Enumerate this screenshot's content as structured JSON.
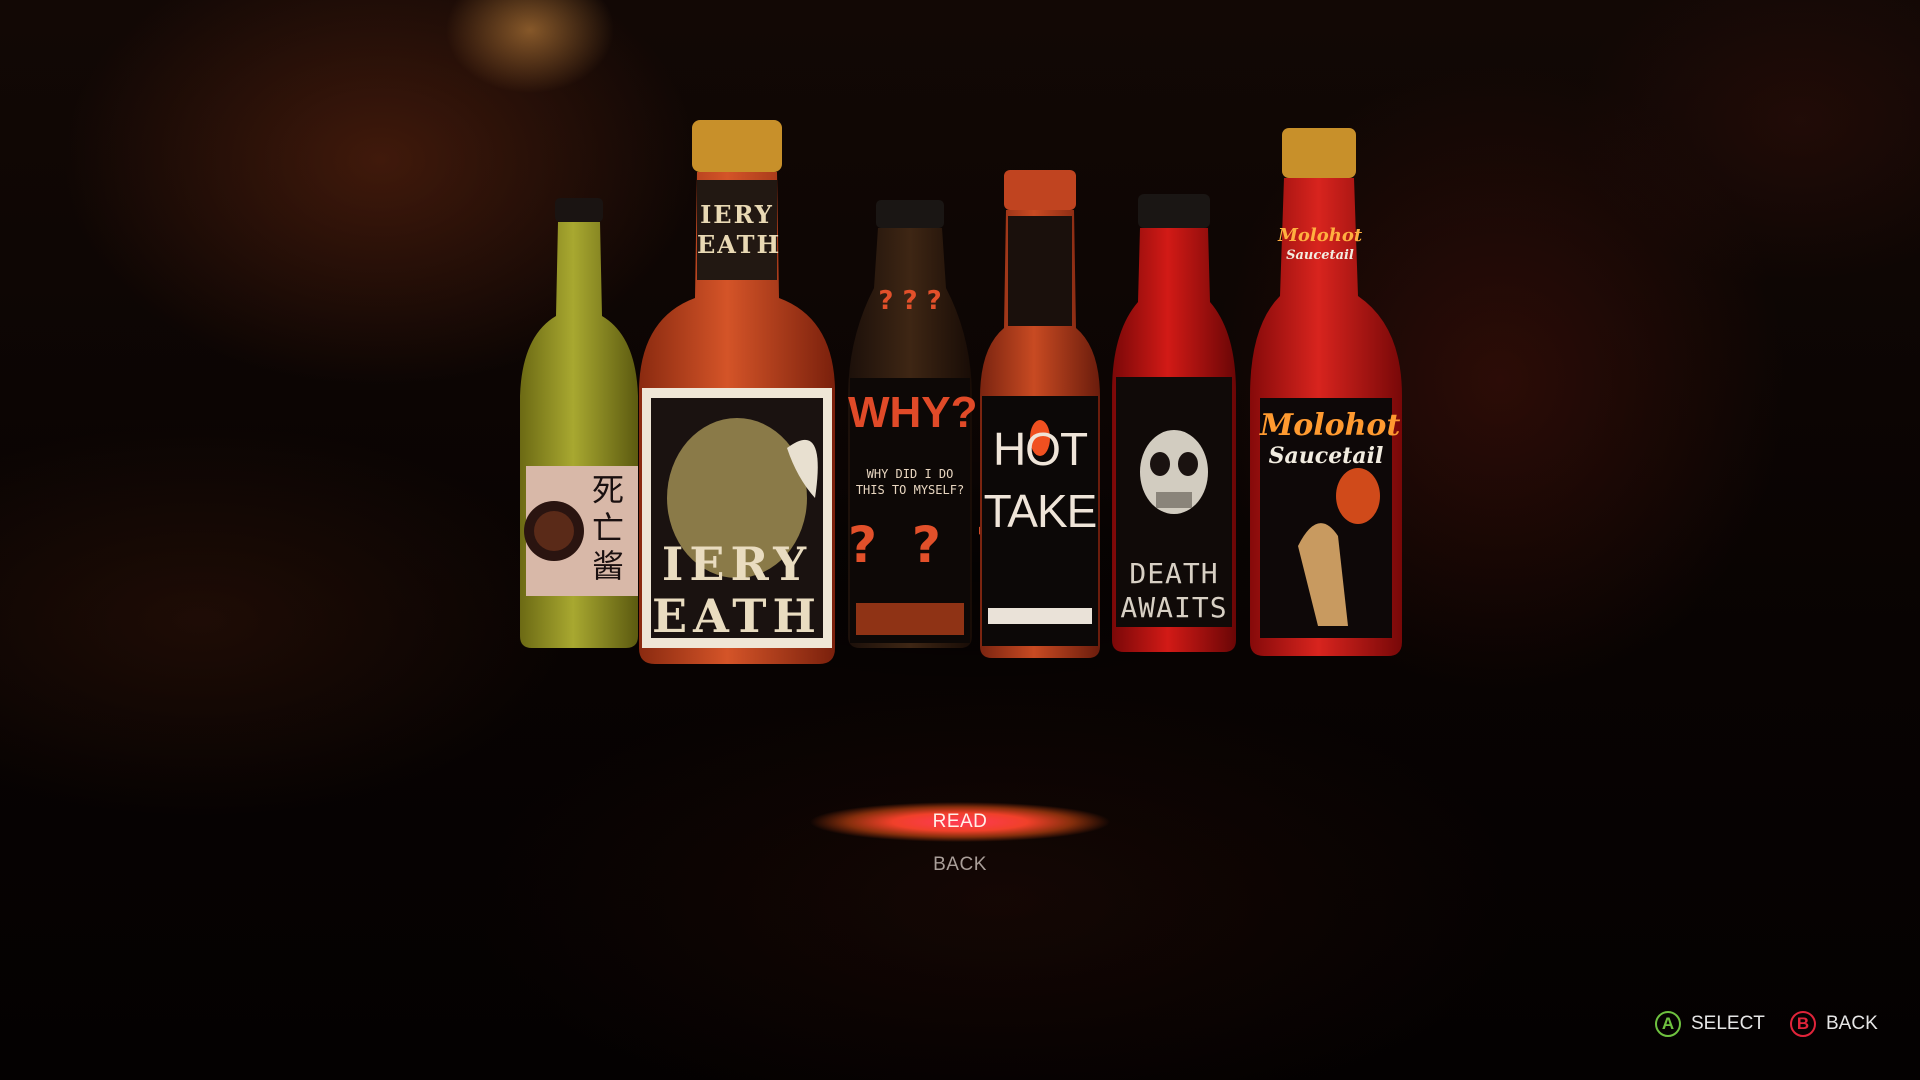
{
  "bottles": [
    {
      "name": "yellow-sauce",
      "label_lines": [
        "死",
        "亡",
        "酱"
      ]
    },
    {
      "name": "fiery-death",
      "neck_label": [
        "IERY",
        "EATH"
      ],
      "label_lines": [
        "IERY",
        "EATH"
      ]
    },
    {
      "name": "why",
      "label_title": "WHY?",
      "label_sub": [
        "WHY DID I DO",
        "THIS TO MYSELF?"
      ],
      "marks": "?  ?  ?",
      "neck_marks": "? ? ?"
    },
    {
      "name": "hot-take",
      "label_lines": [
        "HOT",
        "TAKE"
      ]
    },
    {
      "name": "death-awaits",
      "label_lines": [
        "DEATH",
        "AWAITS"
      ]
    },
    {
      "name": "molohot",
      "neck_label": [
        "Molohot",
        "Saucetail"
      ],
      "label_lines": [
        "Molohot",
        "Saucetail"
      ]
    }
  ],
  "menu": {
    "items": [
      {
        "label": "READ",
        "selected": true
      },
      {
        "label": "BACK",
        "selected": false
      }
    ]
  },
  "hints": {
    "select": {
      "button": "A",
      "label": "SELECT",
      "color": "#6ec13f"
    },
    "back": {
      "button": "B",
      "label": "BACK",
      "color": "#e0243a"
    }
  }
}
